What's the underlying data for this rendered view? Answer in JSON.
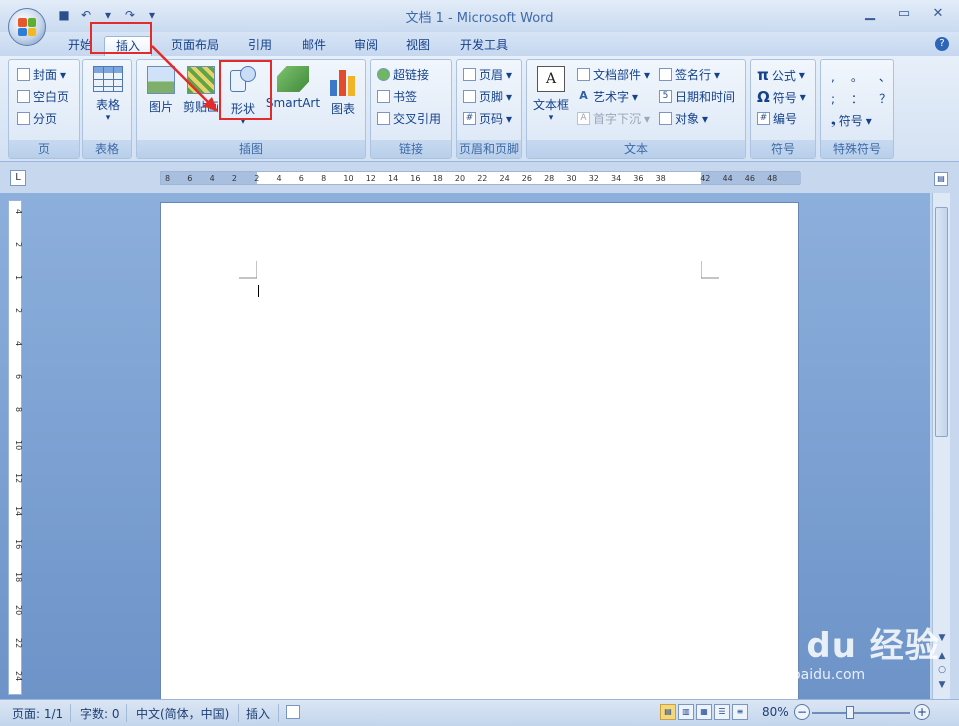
{
  "window": {
    "title": "文档 1 - Microsoft Word"
  },
  "tabs": [
    "开始",
    "插入",
    "页面布局",
    "引用",
    "邮件",
    "审阅",
    "视图",
    "开发工具"
  ],
  "active_tab": "插入",
  "ribbon": {
    "pages": {
      "label": "页",
      "items": [
        "封面",
        "空白页",
        "分页"
      ]
    },
    "table": {
      "label": "表格",
      "button": "表格"
    },
    "illustrations": {
      "label": "插图",
      "buttons": [
        "图片",
        "剪贴画",
        "形状",
        "SmartArt",
        "图表"
      ]
    },
    "links": {
      "label": "链接",
      "items": [
        "超链接",
        "书签",
        "交叉引用"
      ]
    },
    "header_footer": {
      "label": "页眉和页脚",
      "items": [
        "页眉",
        "页脚",
        "页码"
      ]
    },
    "text": {
      "label": "文本",
      "big": "文本框",
      "col1": [
        "文档部件",
        "艺术字",
        "首字下沉"
      ],
      "col2": [
        "签名行",
        "日期和时间",
        "对象"
      ]
    },
    "symbols": {
      "label": "符号",
      "items": [
        "公式",
        "符号",
        "编号"
      ],
      "icons": [
        "π",
        "Ω",
        "#"
      ]
    },
    "special": {
      "label": "特殊符号",
      "row1": [
        ",",
        "。",
        "、"
      ],
      "row2": [
        ";",
        "：",
        "？"
      ],
      "item": "符号"
    }
  },
  "ruler": {
    "h_ticks": [
      "8",
      "6",
      "4",
      "2",
      "2",
      "4",
      "6",
      "8",
      "10",
      "12",
      "14",
      "16",
      "18",
      "20",
      "22",
      "24",
      "26",
      "28",
      "30",
      "32",
      "34",
      "36",
      "38",
      "42",
      "44",
      "46",
      "48"
    ],
    "v_ticks": [
      "4",
      "2",
      "1",
      "2",
      "4",
      "6",
      "8",
      "10",
      "12",
      "14",
      "16",
      "18",
      "20",
      "22",
      "24"
    ],
    "corner": "L"
  },
  "status": {
    "page": "页面: 1/1",
    "words": "字数: 0",
    "language": "中文(简体，中国)",
    "mode": "插入",
    "zoom": "80%"
  },
  "watermark": {
    "line1": "Bai du 经验",
    "line2": "jingyan.baidu.com"
  },
  "colors": {
    "highlight": "#e32b2b",
    "ribbon_text": "#15428b",
    "doc_bg": "#7c9fd0"
  }
}
